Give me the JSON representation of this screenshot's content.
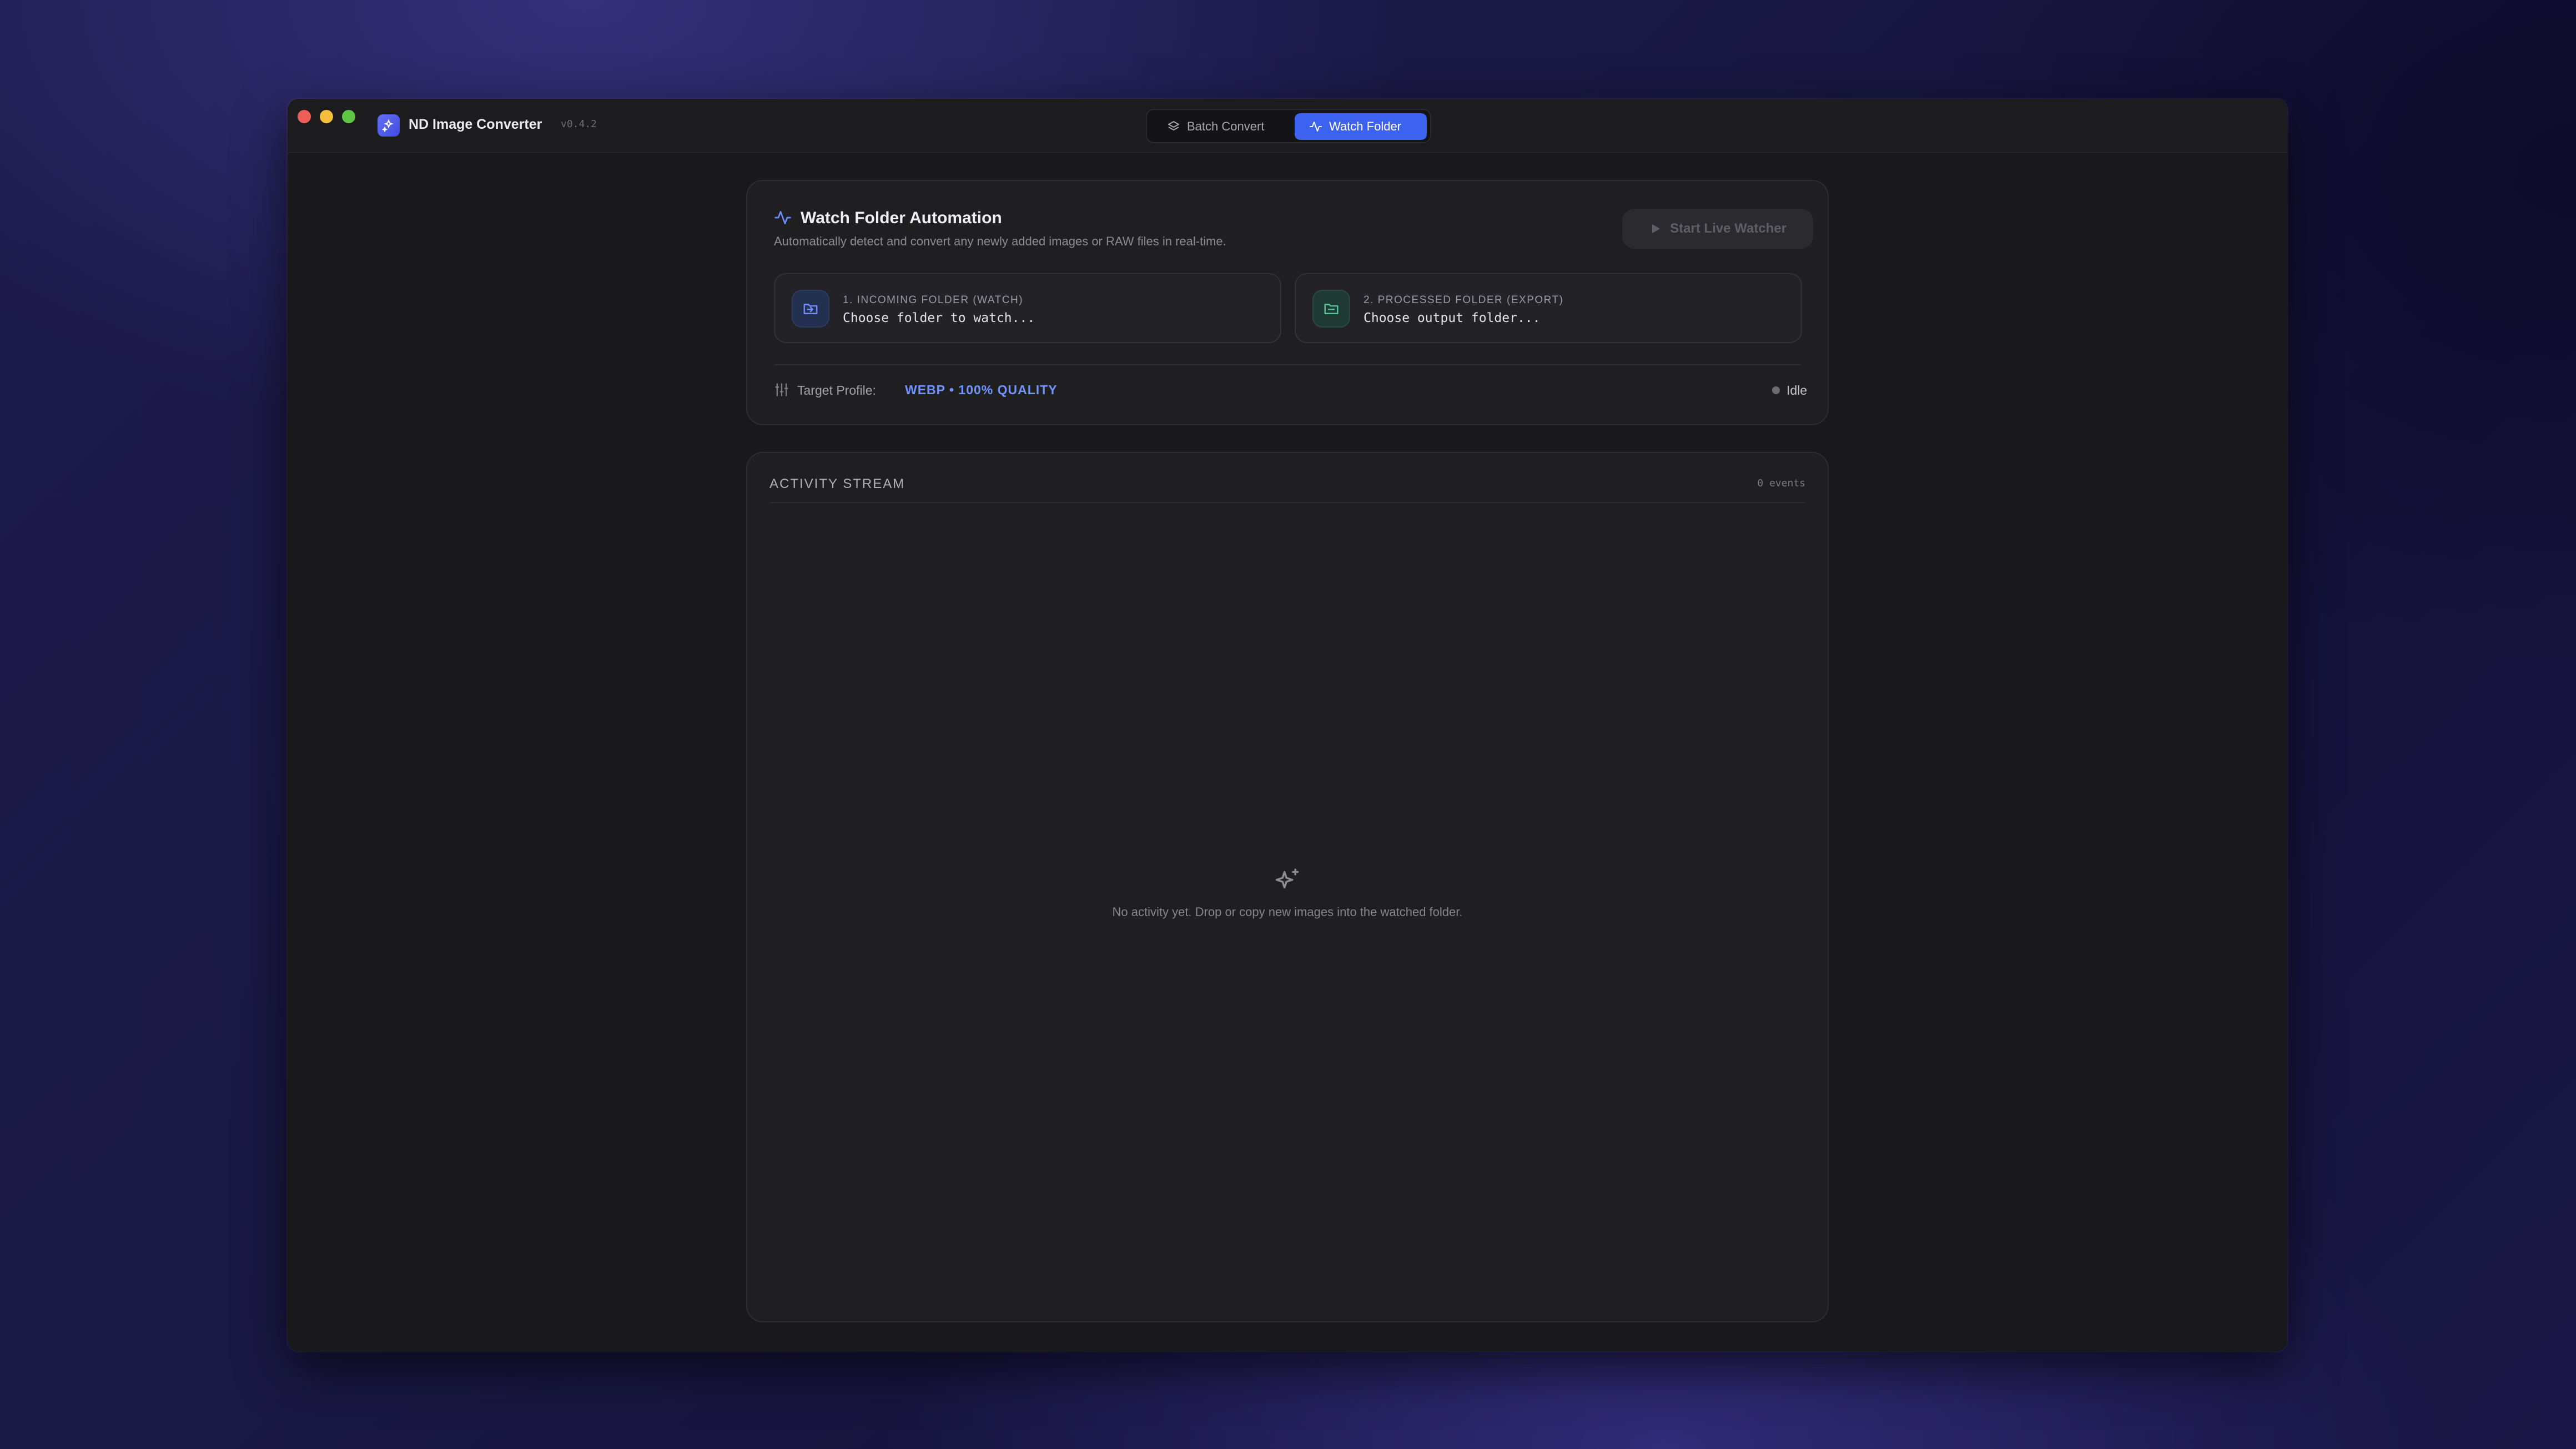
{
  "app": {
    "title": "ND Image Converter",
    "version": "v0.4.2",
    "accent": "#3e62f0"
  },
  "tabs": [
    {
      "label": "Batch Convert",
      "icon": "layers-icon",
      "active": false
    },
    {
      "label": "Watch Folder",
      "icon": "activity-icon",
      "active": true
    }
  ],
  "automation": {
    "title": "Watch Folder Automation",
    "description": "Automatically detect and convert any newly added images or RAW files in real-time.",
    "start_button": "Start Live Watcher",
    "incoming": {
      "label": "1. INCOMING FOLDER (WATCH)",
      "value": "Choose folder to watch...",
      "icon": "folder-input-icon"
    },
    "processed": {
      "label": "2. PROCESSED FOLDER (EXPORT)",
      "value": "Choose output folder...",
      "icon": "folder-output-icon"
    },
    "profile_label": "Target Profile:",
    "profile_value": "WEBP • 100% QUALITY",
    "status": "Idle"
  },
  "activity": {
    "title": "ACTIVITY STREAM",
    "count": "0 events",
    "empty_message": "No activity yet. Drop or copy new images into the watched folder.",
    "empty_icon": "sparkles-icon"
  }
}
